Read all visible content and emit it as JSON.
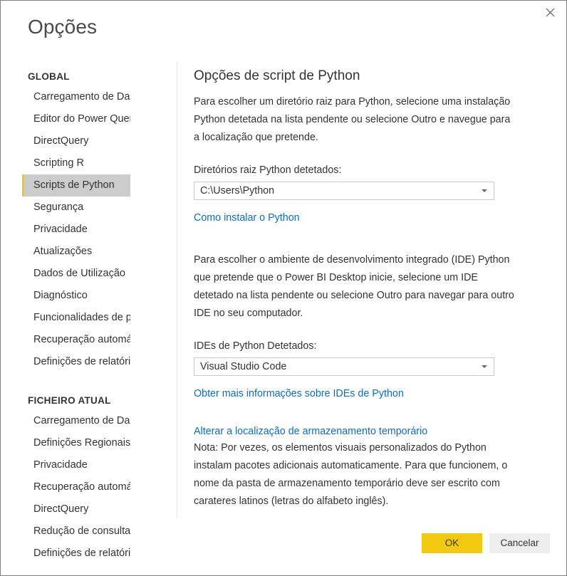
{
  "window": {
    "title": "Opções",
    "close_icon": "close-icon"
  },
  "sidebar": {
    "sections": [
      {
        "title": "GLOBAL",
        "items": [
          {
            "label": "Carregamento de Dados",
            "selected": false
          },
          {
            "label": "Editor do Power Query",
            "selected": false
          },
          {
            "label": "DirectQuery",
            "selected": false
          },
          {
            "label": "Scripting R",
            "selected": false
          },
          {
            "label": "Scripts de Python",
            "selected": true
          },
          {
            "label": "Segurança",
            "selected": false
          },
          {
            "label": "Privacidade",
            "selected": false
          },
          {
            "label": "Atualizações",
            "selected": false
          },
          {
            "label": "Dados de Utilização",
            "selected": false
          },
          {
            "label": "Diagnóstico",
            "selected": false
          },
          {
            "label": "Funcionalidades de pré-visu...",
            "selected": false
          },
          {
            "label": "Recuperação automática",
            "selected": false
          },
          {
            "label": "Definições de relatório",
            "selected": false
          }
        ]
      },
      {
        "title": "FICHEIRO ATUAL",
        "items": [
          {
            "label": "Carregamento de Dados",
            "selected": false
          },
          {
            "label": "Definições Regionais",
            "selected": false
          },
          {
            "label": "Privacidade",
            "selected": false
          },
          {
            "label": "Recuperação automática",
            "selected": false
          },
          {
            "label": "DirectQuery",
            "selected": false
          },
          {
            "label": "Redução de consulta",
            "selected": false
          },
          {
            "label": "Definições de relatório",
            "selected": false
          }
        ]
      }
    ]
  },
  "main": {
    "heading": "Opções de script de Python",
    "intro_paragraph": "Para escolher um diretório raiz para Python, selecione uma instalação Python detetada na lista pendente ou selecione Outro e navegue para a localização que pretende.",
    "home_dirs_label": "Diretórios raiz Python detetados:",
    "home_dirs_value": "C:\\Users\\Python",
    "install_link": "Como instalar o Python",
    "ide_paragraph": "Para escolher o ambiente de desenvolvimento integrado (IDE) Python que pretende que o Power BI Desktop inicie, selecione um IDE detetado na lista pendente ou selecione Outro para navegar para outro IDE no seu computador.",
    "ide_label": "IDEs de Python Detetados:",
    "ide_value": "Visual Studio Code",
    "ide_link": "Obter mais informações sobre IDEs de Python",
    "temp_storage_link": "Alterar a localização de armazenamento temporário",
    "note_paragraph": "Nota: Por vezes, os elementos visuais personalizados do Python instalam pacotes adicionais automaticamente. Para que funcionem, o nome da pasta de armazenamento temporário deve ser escrito com carateres latinos (letras do alfabeto inglês)."
  },
  "footer": {
    "ok_label": "OK",
    "cancel_label": "Cancelar"
  },
  "colors": {
    "accent": "#f2c811",
    "link": "#0f6cbd",
    "selected_row_bg": "#cccccc",
    "text": "#333333",
    "border": "#c8c8c8"
  }
}
